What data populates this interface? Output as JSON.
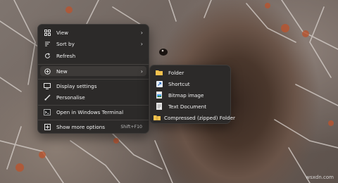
{
  "context_menu": {
    "items": [
      {
        "label": "View",
        "icon": "view-grid-icon",
        "has_submenu": true
      },
      {
        "label": "Sort by",
        "icon": "sort-icon",
        "has_submenu": true
      },
      {
        "label": "Refresh",
        "icon": "refresh-icon",
        "has_submenu": false
      },
      {
        "label": "New",
        "icon": "new-plus-icon",
        "has_submenu": true
      },
      {
        "label": "Display settings",
        "icon": "display-icon",
        "has_submenu": false
      },
      {
        "label": "Personalise",
        "icon": "brush-icon",
        "has_submenu": false
      },
      {
        "label": "Open in Windows Terminal",
        "icon": "terminal-icon",
        "has_submenu": false
      },
      {
        "label": "Show more options",
        "icon": "more-options-icon",
        "shortcut": "Shift+F10"
      }
    ]
  },
  "new_submenu": {
    "items": [
      {
        "label": "Folder",
        "icon": "folder-icon"
      },
      {
        "label": "Shortcut",
        "icon": "shortcut-icon"
      },
      {
        "label": "Bitmap image",
        "icon": "bitmap-icon"
      },
      {
        "label": "Text Document",
        "icon": "text-document-icon"
      },
      {
        "label": "Compressed (zipped) Folder",
        "icon": "zip-folder-icon"
      }
    ]
  },
  "watermark": "wsxdn.com",
  "colors": {
    "menu_bg": "#2c2a29",
    "highlight": "#3d3a38",
    "folder_yellow": "#f2c14e",
    "accent_blue": "#4da3ff"
  }
}
